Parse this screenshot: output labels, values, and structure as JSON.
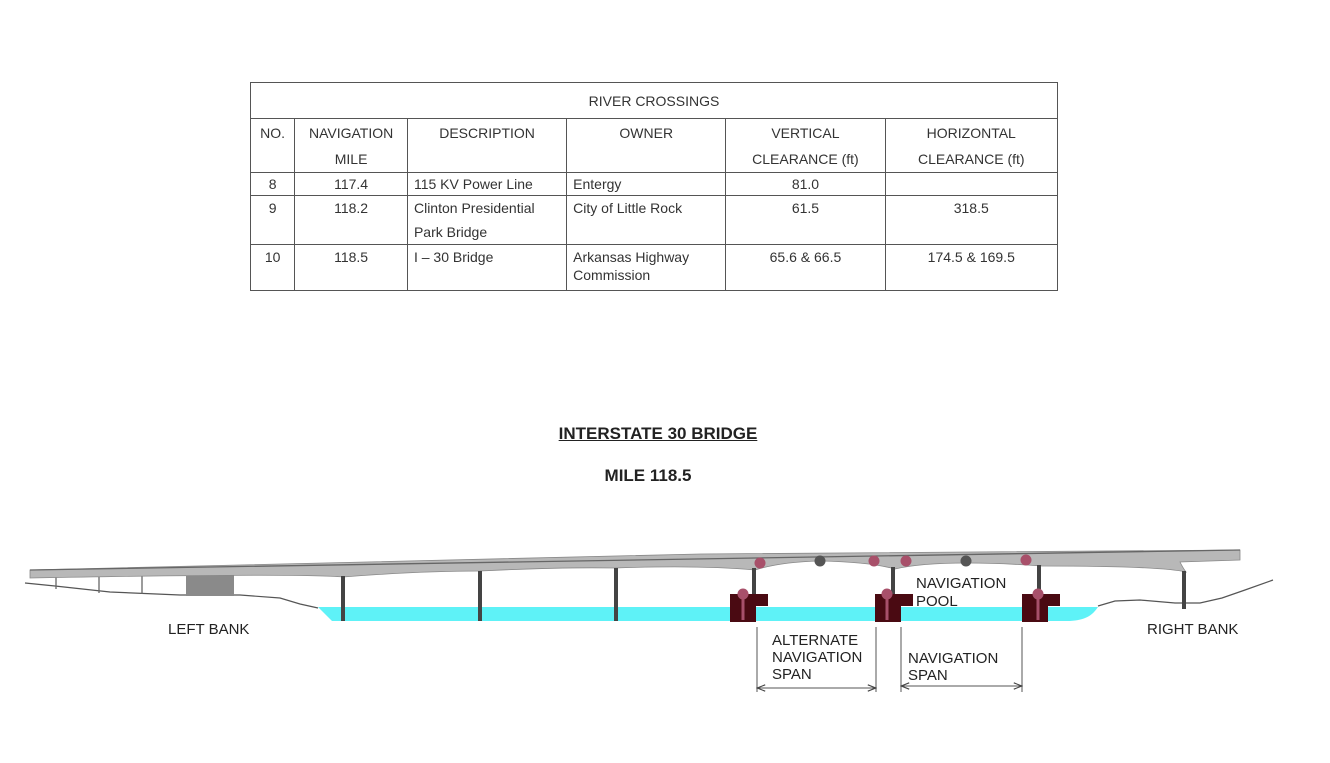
{
  "table": {
    "title": "RIVER CROSSINGS",
    "headers": {
      "no": "NO.",
      "mile": [
        "NAVIGATION",
        "MILE"
      ],
      "description": "DESCRIPTION",
      "owner": "OWNER",
      "vertical": [
        "VERTICAL",
        "CLEARANCE (ft)"
      ],
      "horizontal": [
        "HORIZONTAL",
        "CLEARANCE (ft)"
      ]
    },
    "rows": [
      {
        "no": "8",
        "mile": "117.4",
        "description": [
          "115 KV Power Line"
        ],
        "owner": [
          "Entergy"
        ],
        "vertical": "81.0",
        "horizontal": ""
      },
      {
        "no": "9",
        "mile": "118.2",
        "description": [
          "Clinton Presidential",
          "Park Bridge"
        ],
        "owner": [
          "City of Little Rock"
        ],
        "vertical": "61.5",
        "horizontal": "318.5"
      },
      {
        "no": "10",
        "mile": "118.5",
        "description": [
          "I – 30 Bridge"
        ],
        "owner": [
          "Arkansas Highway",
          "Commission"
        ],
        "vertical": "65.6 & 66.5",
        "horizontal": "174.5 & 169.5"
      }
    ]
  },
  "diagram": {
    "title": "INTERSTATE 30 BRIDGE",
    "subtitle": "MILE 118.5",
    "labels": {
      "left_bank": "LEFT BANK",
      "right_bank": "RIGHT BANK",
      "navigation_pool": [
        "NAVIGATION",
        "POOL"
      ],
      "alternate_span": [
        "ALTERNATE",
        "NAVIGATION",
        "SPAN"
      ],
      "navigation_span": [
        "NAVIGATION",
        "SPAN"
      ]
    },
    "colors": {
      "water": "#5ef2f7",
      "deck": "#b8b8b8",
      "pier": "#444444",
      "fender": "#4a0a12",
      "light_red": "#a8506a",
      "light_gray": "#555555"
    }
  }
}
